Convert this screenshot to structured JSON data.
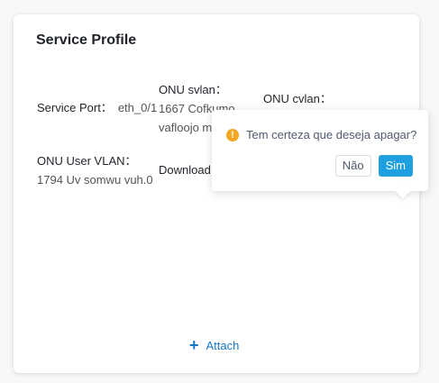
{
  "card": {
    "title": "Service Profile",
    "fields": {
      "service_port": {
        "label": "Service Port：",
        "value": "eth_0/1"
      },
      "onu_svlan": {
        "label": "ONU svlan：",
        "value": "1667 Cofkumo vafloojo m"
      },
      "onu_cvlan": {
        "label": "ONU cvlan："
      },
      "onu_user_vlan": {
        "label": "ONU User VLAN：",
        "value": "1794 Uv somwu vuh.0"
      },
      "download": {
        "label": "Download"
      }
    },
    "attach": {
      "label": "Attach",
      "icon": "plus-icon"
    }
  },
  "popconfirm": {
    "icon": "warning-icon",
    "message": "Tem certeza que deseja apagar?",
    "cancel_label": "Não",
    "confirm_label": "Sim"
  },
  "colors": {
    "accent": "#1677c9",
    "confirm_button": "#1e9fe0",
    "warning": "#f5a623"
  }
}
